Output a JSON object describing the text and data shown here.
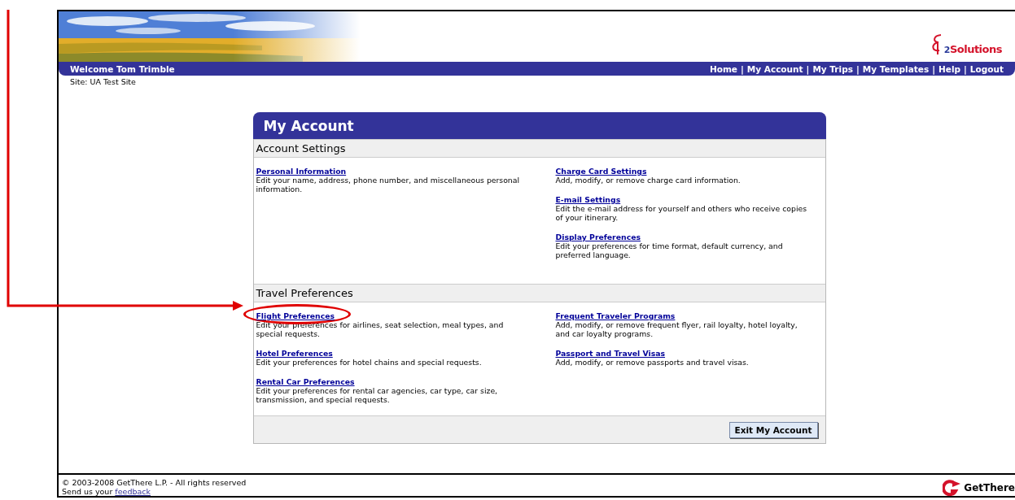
{
  "header": {
    "logo": {
      "mark": "2",
      "name": "Solutions"
    }
  },
  "nav_bar": {
    "welcome": "Welcome Tom Trimble",
    "separator": "|",
    "links": [
      "Home",
      "My Account",
      "My Trips",
      "My Templates",
      "Help",
      "Logout"
    ]
  },
  "site": "Site: UA Test Site",
  "card": {
    "title": "My Account",
    "sections": [
      {
        "title": "Account Settings",
        "columns": [
          [
            {
              "link": "Personal Information",
              "description": "Edit your name, address, phone number, and miscellaneous personal information.",
              "highlighted": false
            }
          ],
          [
            {
              "link": "Charge Card Settings",
              "description": "Add, modify, or remove charge card information.",
              "highlighted": false
            },
            {
              "link": "E-mail Settings",
              "description": "Edit the e-mail address for yourself and others who receive copies of your itinerary.",
              "highlighted": false
            },
            {
              "link": "Display Preferences",
              "description": "Edit your preferences for time format, default currency, and preferred language.",
              "highlighted": false
            }
          ]
        ]
      },
      {
        "title": "Travel Preferences",
        "columns": [
          [
            {
              "link": "Flight Preferences",
              "description": "Edit your preferences for airlines, seat selection, meal types, and special requests.",
              "highlighted": true
            },
            {
              "link": "Hotel Preferences",
              "description": "Edit your preferences for hotel chains and special requests.",
              "highlighted": false
            },
            {
              "link": "Rental Car Preferences",
              "description": "Edit your preferences for rental car agencies, car type, car size, transmission, and special requests.",
              "highlighted": false
            }
          ],
          [
            {
              "link": "Frequent Traveler Programs",
              "description": "Add, modify, or remove frequent flyer, rail loyalty, hotel loyalty, and car loyalty programs.",
              "highlighted": false
            },
            {
              "link": "Passport and Travel Visas",
              "description": "Add, modify, or remove passports and travel visas.",
              "highlighted": false
            }
          ]
        ]
      }
    ],
    "button": "Exit My Account"
  },
  "footer": {
    "copyright": "© 2003-2008 GetThere L.P. - All rights reserved",
    "feedback_prefix": "Send us your",
    "feedback_link": "feedback",
    "logo": "GetThere"
  }
}
